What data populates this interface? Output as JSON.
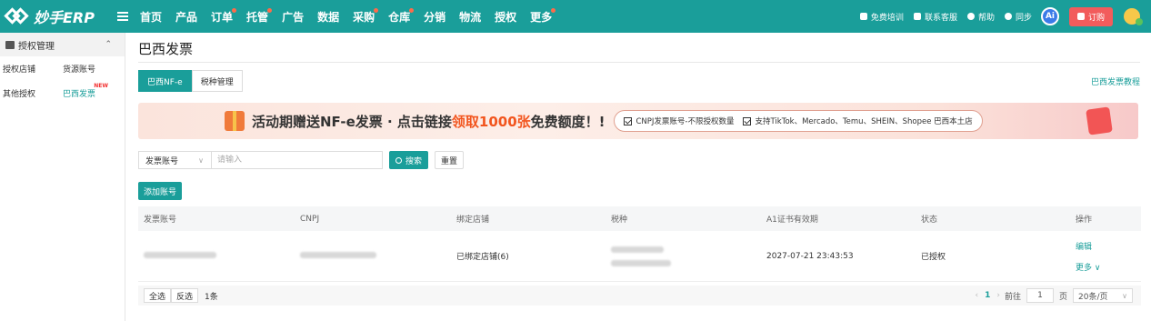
{
  "app": {
    "name": "妙手ERP"
  },
  "nav": [
    {
      "label": "首页",
      "dot": false
    },
    {
      "label": "产品",
      "dot": false
    },
    {
      "label": "订单",
      "dot": true
    },
    {
      "label": "托管",
      "dot": true
    },
    {
      "label": "广告",
      "dot": false
    },
    {
      "label": "数据",
      "dot": false
    },
    {
      "label": "采购",
      "dot": true
    },
    {
      "label": "仓库",
      "dot": true
    },
    {
      "label": "分销",
      "dot": false
    },
    {
      "label": "物流",
      "dot": false
    },
    {
      "label": "授权",
      "dot": false
    },
    {
      "label": "更多",
      "dot": true
    }
  ],
  "topright": {
    "training": "免费培训",
    "support": "联系客服",
    "help": "帮助",
    "sync": "同步",
    "ai": "Ai",
    "order": "订购"
  },
  "sidebar": {
    "section": "授权管理",
    "rows": [
      {
        "left": "授权店铺",
        "right": "货源账号",
        "right_active": false,
        "right_new": ""
      },
      {
        "left": "其他授权",
        "right": "巴西发票",
        "right_active": true,
        "right_new": "NEW"
      }
    ]
  },
  "page": {
    "title": "巴西发票",
    "tabs": [
      {
        "label": "巴西NF-e",
        "active": true
      },
      {
        "label": "税种管理",
        "active": false
      }
    ],
    "tutorial": "巴西发票教程"
  },
  "banner": {
    "text_a": "活动期赠送NF-e发票 · 点击链接",
    "text_hl": "领取1000张",
    "text_b": "免费额度！!",
    "check1": "CNPJ发票账号-不限授权数量",
    "check2": "支持TikTok、Mercado、Temu、SHEIN、Shopee 巴西本土店"
  },
  "search": {
    "field": "发票账号",
    "placeholder": "请输入",
    "search_label": "搜索",
    "reset_label": "重置"
  },
  "add_label": "添加账号",
  "table": {
    "headers": [
      "发票账号",
      "CNPJ",
      "绑定店铺",
      "税种",
      "A1证书有效期",
      "状态",
      "操作"
    ],
    "rows": [
      {
        "shop": "已绑定店铺(6)",
        "expiry": "2027-07-21 23:43:53",
        "status": "已授权",
        "op_edit": "编辑",
        "op_more": "更多"
      }
    ]
  },
  "footer": {
    "select_all": "全选",
    "invert": "反选",
    "count": "1条",
    "goto": "前往",
    "page": "1",
    "page_unit": "页",
    "page_size": "20条/页"
  },
  "colors": {
    "primary": "#1a9e9a",
    "accent_red": "#f2551e"
  }
}
